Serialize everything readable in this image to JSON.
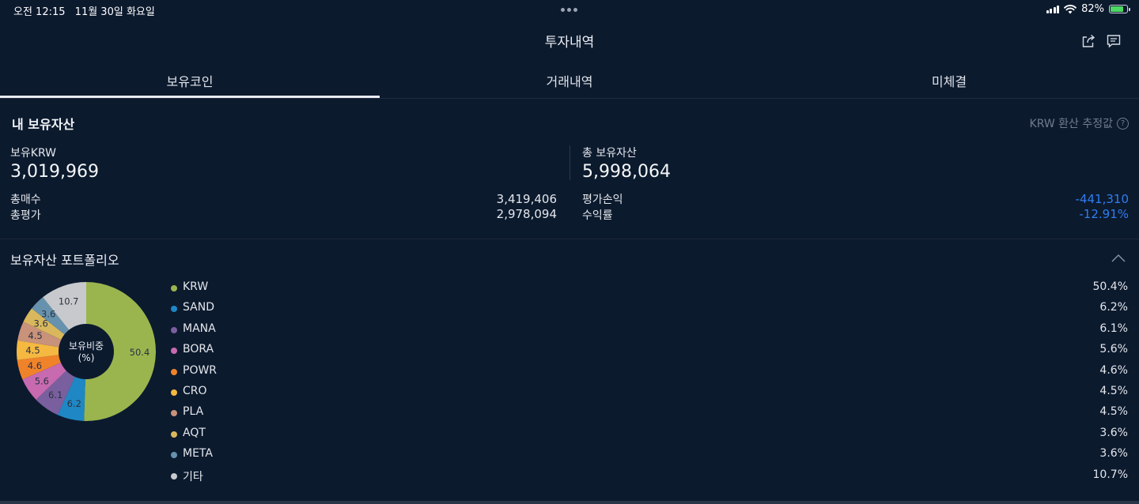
{
  "status_bar": {
    "time": "오전 12:15",
    "date": "11월 30일 화요일",
    "battery": "82%"
  },
  "header": {
    "title": "투자내역",
    "icons": [
      "share-icon",
      "chat-icon"
    ]
  },
  "tabs": [
    {
      "label": "보유코인",
      "active": true
    },
    {
      "label": "거래내역",
      "active": false
    },
    {
      "label": "미체결",
      "active": false
    }
  ],
  "assets": {
    "title": "내 보유자산",
    "krw_note": "KRW 환산 추정값",
    "krw_label": "보유KRW",
    "krw_value": "3,019,969",
    "total_assets_label": "총 보유자산",
    "total_assets_value": "5,998,064",
    "total_buy_label": "총매수",
    "total_buy_value": "3,419,406",
    "total_eval_label": "총평가",
    "total_eval_value": "2,978,094",
    "pnl_label": "평가손익",
    "pnl_value": "-441,310",
    "return_label": "수익률",
    "return_value": "-12.91%"
  },
  "portfolio": {
    "title": "보유자산 포트폴리오",
    "center_label_1": "보유비중",
    "center_label_2": "(%)",
    "colors": {
      "KRW": "#9ab54e",
      "SAND": "#1f88c4",
      "MANA": "#7a5f9e",
      "BORA": "#c76aaf",
      "POWR": "#f0832a",
      "CRO": "#f5b841",
      "PLA": "#c9927a",
      "AQT": "#d9b85d",
      "META": "#6792ae",
      "기타": "#c7c9cc"
    },
    "items": [
      {
        "name": "KRW",
        "pct": "50.4%",
        "value": 50.4,
        "label": "50.4"
      },
      {
        "name": "SAND",
        "pct": "6.2%",
        "value": 6.2,
        "label": "6.2"
      },
      {
        "name": "MANA",
        "pct": "6.1%",
        "value": 6.1,
        "label": "6.1"
      },
      {
        "name": "BORA",
        "pct": "5.6%",
        "value": 5.6,
        "label": "5.6"
      },
      {
        "name": "POWR",
        "pct": "4.6%",
        "value": 4.6,
        "label": "4.6"
      },
      {
        "name": "CRO",
        "pct": "4.5%",
        "value": 4.5,
        "label": "4.5"
      },
      {
        "name": "PLA",
        "pct": "4.5%",
        "value": 4.5,
        "label": "4.5"
      },
      {
        "name": "AQT",
        "pct": "3.6%",
        "value": 3.6,
        "label": "3.6"
      },
      {
        "name": "META",
        "pct": "3.6%",
        "value": 3.6,
        "label": "3.6"
      },
      {
        "name": "기타",
        "pct": "10.7%",
        "value": 10.7,
        "label": "10.7"
      }
    ]
  },
  "chart_data": {
    "type": "pie",
    "categories": [
      "KRW",
      "SAND",
      "MANA",
      "BORA",
      "POWR",
      "CRO",
      "PLA",
      "AQT",
      "META",
      "기타"
    ],
    "values": [
      50.4,
      6.2,
      6.1,
      5.6,
      4.6,
      4.5,
      4.5,
      3.6,
      3.6,
      10.7
    ]
  }
}
